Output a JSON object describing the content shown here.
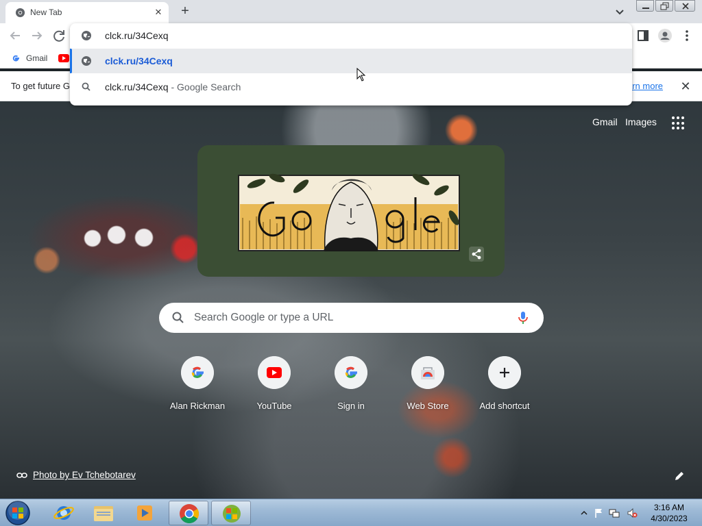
{
  "tab": {
    "title": "New Tab",
    "close": "✕"
  },
  "new_tab_button": "+",
  "omnibox": {
    "input_value": "clck.ru/34Cexq",
    "suggestions": [
      {
        "text": "clck.ru/34Cexq",
        "sub": ""
      },
      {
        "text": "clck.ru/34Cexq",
        "sub": " - Google Search"
      }
    ]
  },
  "bookmarks": [
    {
      "label": "Gmail"
    }
  ],
  "infobar": {
    "text": "To get future G",
    "link": "arn more",
    "close": "✕"
  },
  "ntp": {
    "gmail_link": "Gmail",
    "images_link": "Images",
    "doodle_alt": "Google",
    "search_placeholder": "Search Google or type a URL",
    "shortcuts": [
      {
        "label": "Alan Rickman",
        "icon": "google-icon"
      },
      {
        "label": "YouTube",
        "icon": "youtube-icon"
      },
      {
        "label": "Sign in",
        "icon": "google-icon"
      },
      {
        "label": "Web Store",
        "icon": "webstore-icon"
      },
      {
        "label": "Add shortcut",
        "icon": "plus-icon"
      }
    ],
    "photo_credit": "Photo by Ev Tchebotarev"
  },
  "taskbar": {
    "clock_time": "3:16 AM",
    "clock_date": "4/30/2023"
  },
  "colors": {
    "accent": "#1a73e8",
    "doodle_bg": "#3b4e34",
    "taskbar": "#9ebad6"
  }
}
